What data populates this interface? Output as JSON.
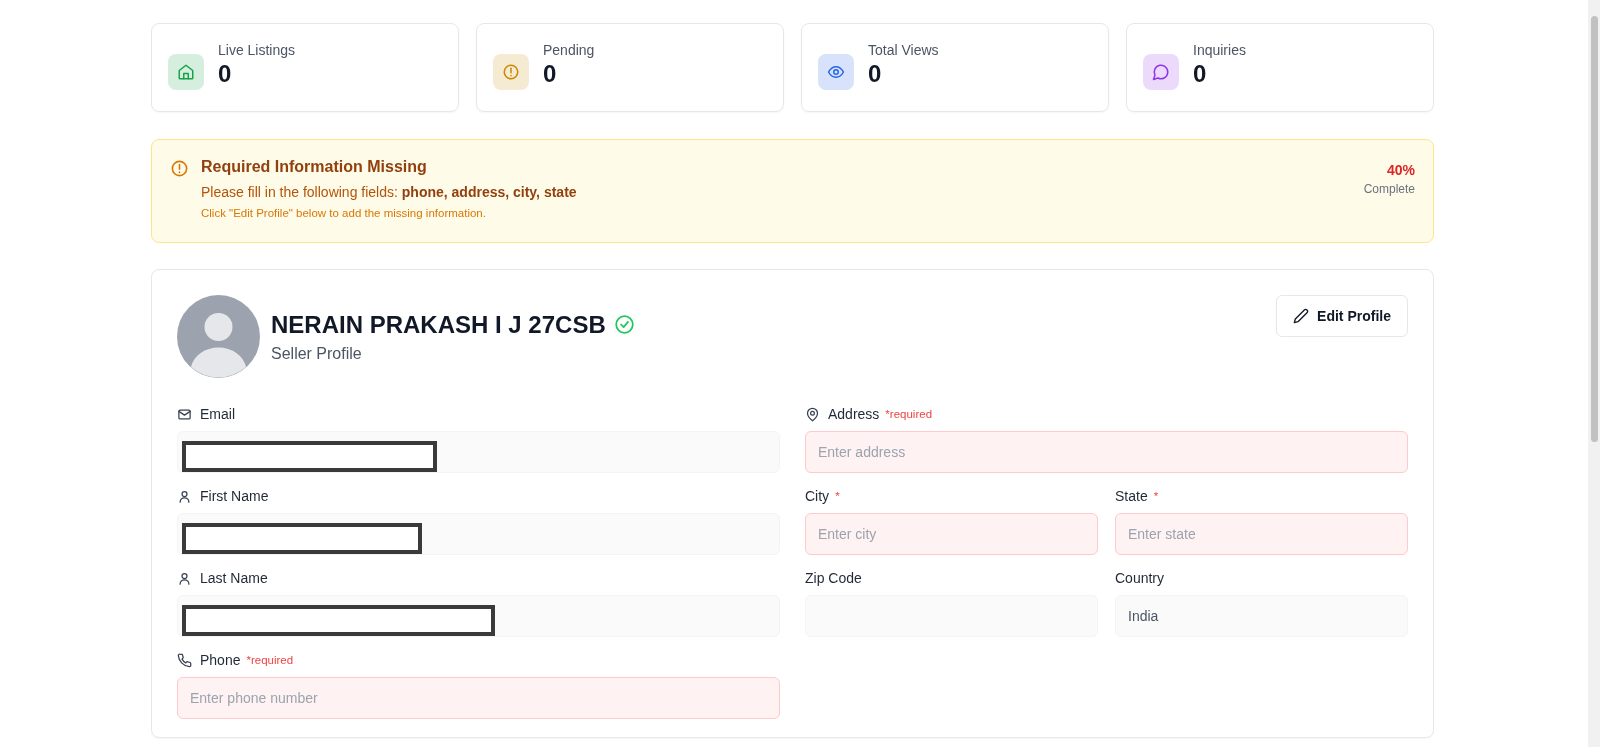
{
  "stats": [
    {
      "label": "Live Listings",
      "value": "0",
      "kind": "home",
      "color": "#16a34a"
    },
    {
      "label": "Pending",
      "value": "0",
      "kind": "alert",
      "color": "#ca8a04"
    },
    {
      "label": "Total Views",
      "value": "0",
      "kind": "eye",
      "color": "#2563eb"
    },
    {
      "label": "Inquiries",
      "value": "0",
      "kind": "chat",
      "color": "#9333ea"
    }
  ],
  "alert": {
    "title": "Required Information Missing",
    "message": "Please fill in the following fields: **phone, address, city, state**",
    "hint": "Click \"Edit Profile\" below to add the missing information.",
    "percent": "40%",
    "percent_label": "Complete"
  },
  "profile": {
    "name": "NERAIN PRAKASH I J 27CSB",
    "verified": true,
    "subtitle": "Seller Profile",
    "edit_button": "Edit Profile"
  },
  "left_fields": [
    {
      "label": "Email",
      "kind": "mail",
      "redacted": true,
      "invalid": false
    },
    {
      "label": "First Name",
      "kind": "user",
      "redacted": true,
      "invalid": false
    },
    {
      "label": "Last Name",
      "kind": "user",
      "redacted": true,
      "invalid": false
    },
    {
      "label": "Phone",
      "kind": "phone",
      "marker": "*required",
      "placeholder": "Enter phone number",
      "invalid": true
    }
  ],
  "right_fields": [
    [
      {
        "label": "Address",
        "kind": "pin",
        "marker": "*required",
        "placeholder": "Enter address",
        "invalid": true
      }
    ],
    [
      {
        "label": "City",
        "kind": "plain",
        "marker": "*",
        "placeholder": "Enter city",
        "invalid": true
      },
      {
        "label": "State",
        "kind": "plain",
        "marker": "*",
        "placeholder": "Enter state",
        "invalid": true
      }
    ],
    [
      {
        "label": "Zip Code",
        "kind": "plain",
        "invalid": false
      },
      {
        "label": "Country",
        "kind": "plain",
        "value": "India",
        "invalid": false
      }
    ]
  ]
}
